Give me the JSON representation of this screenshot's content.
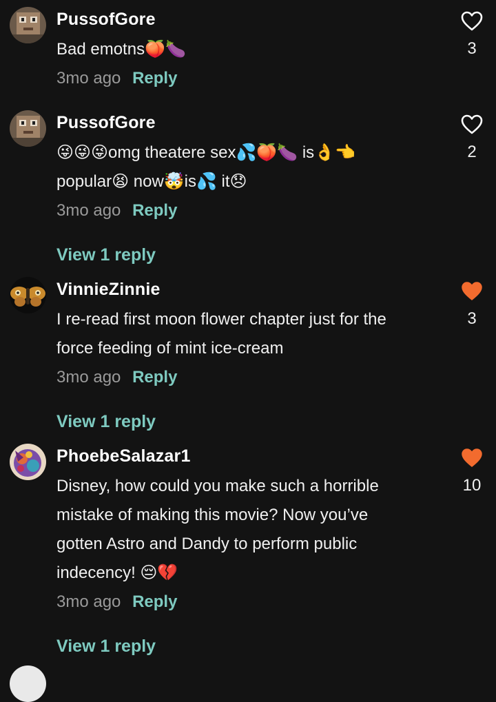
{
  "comments": [
    {
      "username": "PussofGore",
      "text": "Bad emotns🍑🍆",
      "time": "3mo ago",
      "reply_label": "Reply",
      "likes": "3",
      "liked": false
    },
    {
      "username": "PussofGore",
      "text_line1": "😜😜😜omg theatere sex💦🍑🍆 is👌👈",
      "text_line2": "popular😫 now🤯is💦 it😞",
      "time": "3mo ago",
      "reply_label": "Reply",
      "likes": "2",
      "liked": false,
      "view_replies": "View 1 reply"
    },
    {
      "username": "VinnieZinnie",
      "text_line1": "I re-read first moon flower chapter just for the",
      "text_line2": "force feeding of mint ice-cream",
      "time": "3mo ago",
      "reply_label": "Reply",
      "likes": "3",
      "liked": true,
      "view_replies": "View 1 reply"
    },
    {
      "username": "PhoebeSalazar1",
      "text_line1": "Disney, how could you make such a horrible",
      "text_line2": "mistake of making this movie? Now you’ve",
      "text_line3": "gotten Astro and Dandy to perform public",
      "text_line4": "indecency! 😔💔",
      "time": "3mo ago",
      "reply_label": "Reply",
      "likes": "10",
      "liked": true,
      "view_replies": "View 1 reply"
    }
  ],
  "colors": {
    "background": "#131313",
    "accent_teal": "#7ecac0",
    "heart_liked": "#f26b2e",
    "muted_text": "#9a9a9a"
  },
  "icons": {
    "like_outline": "heart-outline-icon",
    "like_filled": "heart-filled-icon"
  }
}
